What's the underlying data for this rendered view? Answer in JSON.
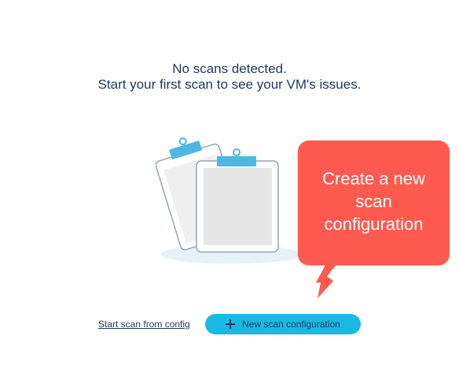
{
  "empty_state": {
    "line1": "No scans detected.",
    "line2": "Start your first scan to see your VM's issues."
  },
  "callout": {
    "line1": "Create a new",
    "line2": "scan",
    "line3": "configuration"
  },
  "actions": {
    "start_scan_link": "Start scan from config",
    "new_scan_button": "New scan configuration"
  },
  "icons": {
    "illustration": "clipboards-illustration",
    "button_icon": "plus-icon",
    "callout_pointer": "arrow-icon"
  },
  "colors": {
    "primary_button": "#1ab9e3",
    "callout": "#ff5a4f",
    "text": "#1f3a5a",
    "clip": "#4fb6e6"
  }
}
